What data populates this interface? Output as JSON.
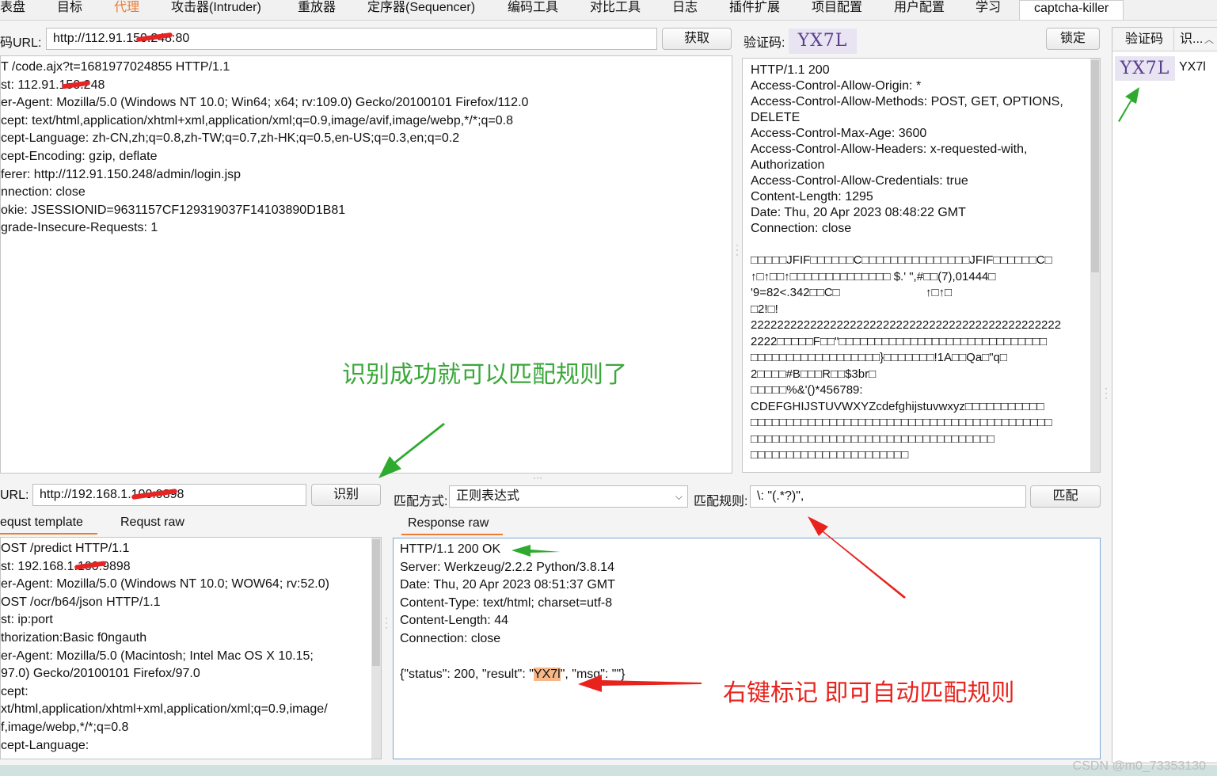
{
  "tabs": [
    "表盘",
    "目标",
    "代理",
    "攻击器(Intruder)",
    "重放器",
    "定序器(Sequencer)",
    "编码工具",
    "对比工具",
    "日志",
    "插件扩展",
    "项目配置",
    "用户配置",
    "学习",
    "captcha-killer"
  ],
  "captcha": {
    "url_label": "码URL:",
    "url_value": "http://112.91.150.248:80",
    "fetch_button": "获取",
    "captcha_label": "验证码:",
    "captcha_text": "YX7L",
    "lock_button": "锁定",
    "request_lines": [
      "T /code.ajx?t=1681977024855 HTTP/1.1",
      "st: 112.91.150.248",
      "er-Agent: Mozilla/5.0 (Windows NT 10.0; Win64; x64; rv:109.0) Gecko/20100101 Firefox/112.0",
      "cept: text/html,application/xhtml+xml,application/xml;q=0.9,image/avif,image/webp,*/*;q=0.8",
      "cept-Language: zh-CN,zh;q=0.8,zh-TW;q=0.7,zh-HK;q=0.5,en-US;q=0.3,en;q=0.2",
      "cept-Encoding: gzip, deflate",
      "ferer: http://112.91.150.248/admin/login.jsp",
      "nnection: close",
      "okie: JSESSIONID=9631157CF129319037F14103890D1B81",
      "grade-Insecure-Requests: 1"
    ],
    "response_lines": [
      "HTTP/1.1 200",
      "Access-Control-Allow-Origin: *",
      "Access-Control-Allow-Methods: POST, GET, OPTIONS,",
      "DELETE",
      "Access-Control-Max-Age: 3600",
      "Access-Control-Allow-Headers: x-requested-with,",
      "Authorization",
      "Access-Control-Allow-Credentials: true",
      "Content-Length: 1295",
      "Date: Thu, 20 Apr 2023 08:48:22 GMT",
      "Connection: close"
    ],
    "binary_lines": [
      "□□□□□JFIF□□□□□□C□□□□□□□□□□□□□□□JFIF□□□□□□C□",
      "↑□↑□□↑□□□□□□□□□□□□□□ $.' \",#□□(7),01444□",
      "'9=82<.342□□C□                          ↑□↑□",
      "□2!□!",
      "22222222222222222222222222222222222222222222222",
      "2222□□□□□F□□\"□□□□□□□□□□□□□□□□□□□□□□□□□□□□□",
      "□□□□□□□□□□□□□□□□□□}□□□□□□□!1A□□Qa□\"q□",
      "2□□□□#B□□□R□□$3br□",
      "□□□□□%&'()*456789:",
      "CDEFGHIJSTUVWXYZcdefghijstuvwxyz□□□□□□□□□□□",
      "□□□□□□□□□□□□□□□□□□□□□□□□□□□□□□□□□□□□□□□□□□",
      "□□□□□□□□□□□□□□□□□□□□□□□□□□□□□□□□□□",
      "□□□□□□□□□□□□□□□□□□□□□□"
    ]
  },
  "history": {
    "col_captcha": "验证码",
    "col_result": "识...",
    "row_image": "YX7L",
    "row_result": "YX7l"
  },
  "ocr": {
    "url_label": "URL:",
    "url_value": "http://192.168.1.100:9898",
    "identify_button": "识别",
    "tab_template": "equst template",
    "tab_raw": "Requst raw",
    "template_lines": [
      "OST /predict HTTP/1.1",
      "st: 192.168.1.100:9898",
      "er-Agent: Mozilla/5.0 (Windows NT 10.0; WOW64; rv:52.0)",
      "OST /ocr/b64/json HTTP/1.1",
      "st: ip:port",
      "thorization:Basic f0ngauth",
      "er-Agent: Mozilla/5.0 (Macintosh; Intel Mac OS X 10.15;",
      "97.0) Gecko/20100101 Firefox/97.0",
      "cept:",
      "xt/html,application/xhtml+xml,application/xml;q=0.9,image/",
      "f,image/webp,*/*;q=0.8",
      "cept-Language:"
    ]
  },
  "match": {
    "mode_label": "匹配方式:",
    "mode_value": "正则表达式",
    "rule_label": "匹配规则:",
    "rule_value": "\\: \"(.*?)\",",
    "match_button": "匹配",
    "tab_response_raw": "Response raw",
    "response_lines": [
      "HTTP/1.1 200 OK",
      "Server: Werkzeug/2.2.2 Python/3.8.14",
      "Date: Thu, 20 Apr 2023 08:51:37 GMT",
      "Content-Type: text/html; charset=utf-8",
      "Content-Length: 44",
      "Connection: close",
      ""
    ],
    "json_prefix": "{\"status\": 200, \"result\": \"",
    "json_highlight": "YX7l",
    "json_suffix": "\", \"msg\": \"\"}"
  },
  "annotations": {
    "note_success": "识别成功就可以匹配规则了",
    "note_rightclick": "右键标记 即可自动匹配规则",
    "success_color": "#3aa83a",
    "rightclick_color": "#e8231d"
  },
  "watermark": "CSDN @m0_73353130",
  "colors": {
    "accent": "#f07a30",
    "arrow_green": "#2eaa2e",
    "arrow_red": "#e8231d"
  }
}
